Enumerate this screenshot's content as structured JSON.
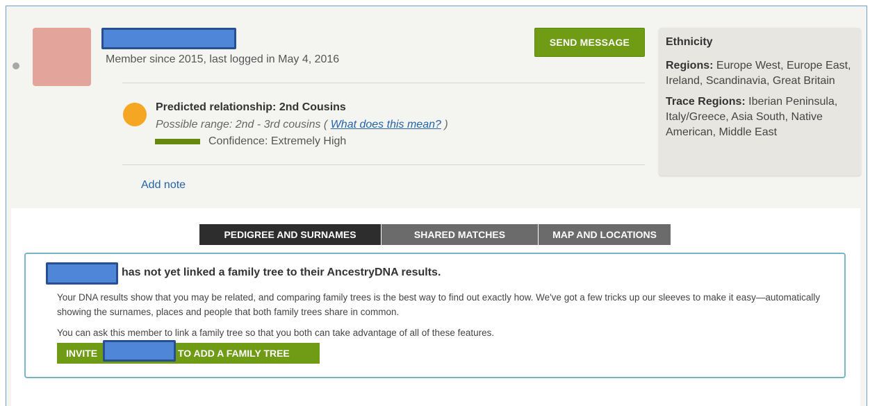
{
  "profile": {
    "member_since": "Member since 2015, last logged in May 4, 2016",
    "send_message_label": "SEND MESSAGE",
    "avatar_color": "#e2a49b",
    "status": "offline"
  },
  "relationship": {
    "predicted": "Predicted relationship: 2nd Cousins",
    "range_prefix": "Possible range: 2nd - 3rd cousins ( ",
    "range_link": "What does this mean?",
    "range_suffix": " )",
    "confidence": "Confidence: Extremely High",
    "confidence_color": "#66880f",
    "indicator_color": "#f5a623",
    "add_note_label": "Add note"
  },
  "ethnicity": {
    "title": "Ethnicity",
    "regions_label": "Regions:",
    "regions_value": " Europe West, Europe East, Ireland, Scandinavia, Great Britain",
    "trace_label": "Trace Regions:",
    "trace_value": " Iberian Peninsula, Italy/Greece, Asia South, Native American, Middle East"
  },
  "tabs": [
    {
      "label": "PEDIGREE AND SURNAMES",
      "active": true
    },
    {
      "label": "SHARED MATCHES",
      "active": false
    },
    {
      "label": "MAP AND LOCATIONS",
      "active": false
    }
  ],
  "notice": {
    "title": "has not yet linked a family tree to their AncestryDNA results.",
    "body": "Your DNA results show that you may be related, and comparing family trees is the best way to find out exactly how. We've got a few tricks up our sleeves to make it easy—automatically showing the surnames, places and people that both family trees share in common.",
    "ask": "You can ask this member to link a family tree so that you both can take advantage of all of these features.",
    "invite_prefix": "INVITE",
    "invite_suffix": "TO ADD A FAMILY TREE"
  },
  "colors": {
    "accent_green": "#6f9b15",
    "link_blue": "#2564a8",
    "notice_border": "#79b4c9",
    "frame_border": "#6e9ec9"
  }
}
